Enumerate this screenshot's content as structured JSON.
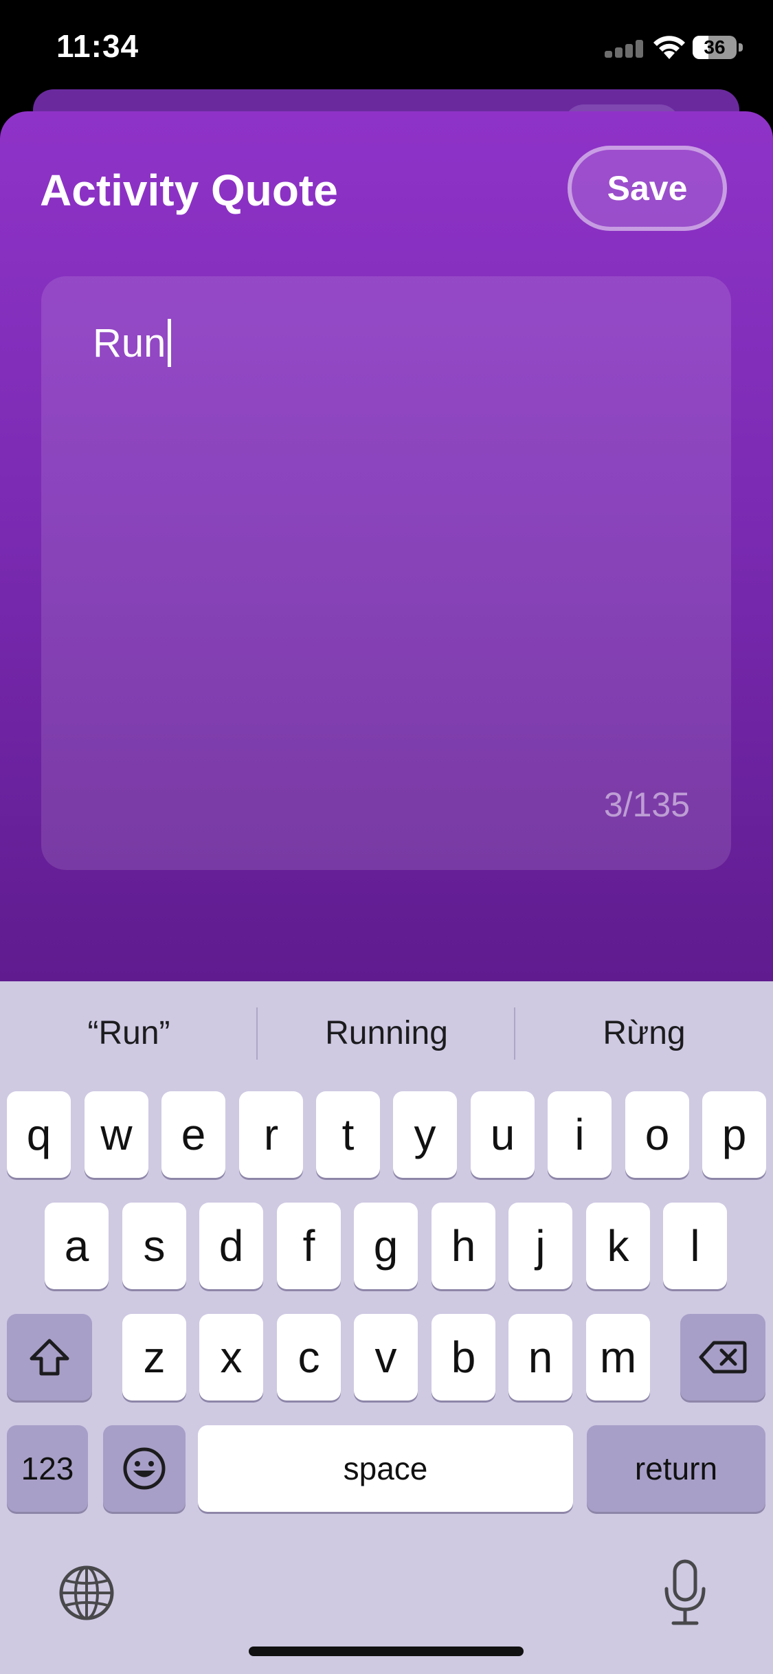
{
  "status_bar": {
    "time": "11:34",
    "battery": "36",
    "battery_percent": 36
  },
  "sheet": {
    "title": "Activity Quote",
    "save_label": "Save"
  },
  "quote": {
    "text": "Run",
    "counter": "3/135"
  },
  "suggestions": [
    "“Run”",
    "Running",
    "Rừng"
  ],
  "keyboard": {
    "row1": [
      "q",
      "w",
      "e",
      "r",
      "t",
      "y",
      "u",
      "i",
      "o",
      "p"
    ],
    "row2": [
      "a",
      "s",
      "d",
      "f",
      "g",
      "h",
      "j",
      "k",
      "l"
    ],
    "row3": [
      "z",
      "x",
      "c",
      "v",
      "b",
      "n",
      "m"
    ],
    "numbers_label": "123",
    "space_label": "space",
    "return_label": "return",
    "icons": [
      "shift-icon",
      "delete-icon",
      "emoji-icon",
      "globe-icon",
      "microphone-icon"
    ]
  },
  "colors": {
    "sheet_top": "#8f33c8",
    "sheet_bottom": "#5f1b8e",
    "keyboard_bg": "#cfc9e2",
    "special_key": "#a89fc8"
  }
}
